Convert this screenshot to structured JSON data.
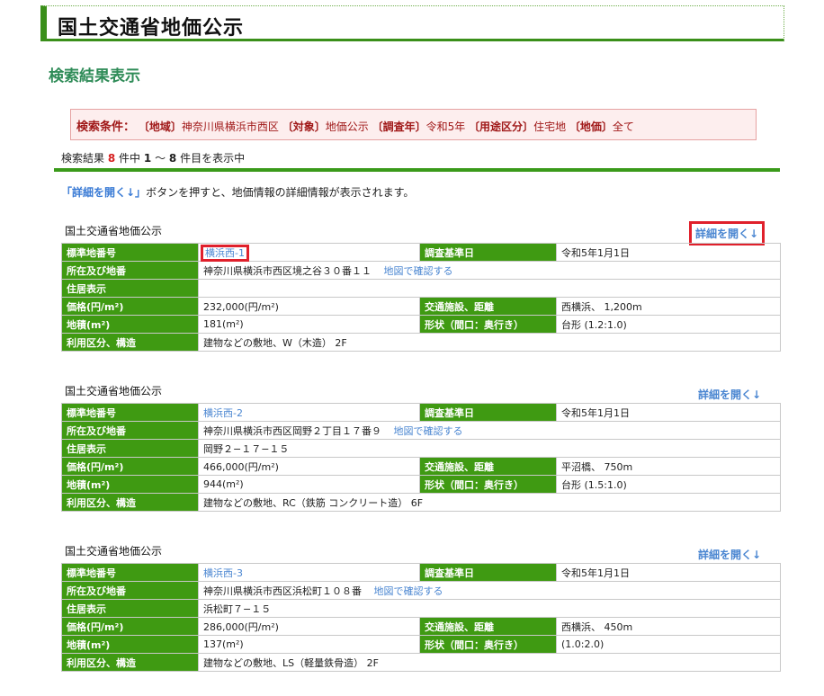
{
  "header": {
    "title": "国土交通省地価公示"
  },
  "section_title": "検索結果表示",
  "conditions": {
    "lead": "検索条件：",
    "region_label": "〔地域〕",
    "region_value": "神奈川県横浜市西区",
    "target_label": "〔対象〕",
    "target_value": "地価公示",
    "year_label": "〔調査年〕",
    "year_value": "令和5年",
    "use_label": "〔用途区分〕",
    "use_value": "住宅地",
    "price_label": "〔地価〕",
    "price_value": "全て"
  },
  "result_count": {
    "prefix": "検索結果",
    "total": "8",
    "mid": "件中",
    "from": "1",
    "tilde": "～",
    "to": "8",
    "suffix": "件目を表示中"
  },
  "instruction": {
    "link_text": "「詳細を開く↓」",
    "rest": "ボタンを押すと、地価情報の詳細情報が表示されます。"
  },
  "labels": {
    "std_no": "標準地番号",
    "survey_date": "調査基準日",
    "location": "所在及び地番",
    "residence": "住居表示",
    "price": "価格(円/m²)",
    "transport": "交通施設、距離",
    "area": "地積(m²)",
    "shape": "形状（間口：奥行き）",
    "usage": "利用区分、構造",
    "map_link": "地図で確認する"
  },
  "records": [
    {
      "block_title": "国土交通省地価公示",
      "detail_link": "詳細を開く↓",
      "std_no": "横浜西-1",
      "survey_date": "令和5年1月1日",
      "location": "神奈川県横浜市西区境之谷３０番１１",
      "residence": "",
      "price": "232,000(円/m²)",
      "transport": "西横浜、 1,200m",
      "area": "181(m²)",
      "shape": "台形 (1.2:1.0)",
      "usage": "建物などの敷地、W（木造） 2F"
    },
    {
      "block_title": "国土交通省地価公示",
      "detail_link": "詳細を開く↓",
      "std_no": "横浜西-2",
      "survey_date": "令和5年1月1日",
      "location": "神奈川県横浜市西区岡野２丁目１７番９",
      "residence": "岡野２−１７−１５",
      "price": "466,000(円/m²)",
      "transport": "平沼橋、 750m",
      "area": "944(m²)",
      "shape": "台形 (1.5:1.0)",
      "usage": "建物などの敷地、RC（鉄筋 コンクリート造） 6F"
    },
    {
      "block_title": "国土交通省地価公示",
      "detail_link": "詳細を開く↓",
      "std_no": "横浜西-3",
      "survey_date": "令和5年1月1日",
      "location": "神奈川県横浜市西区浜松町１０８番",
      "residence": "浜松町７−１５",
      "price": "286,000(円/m²)",
      "transport": "西横浜、 450m",
      "area": "137(m²)",
      "shape": "(1.0:2.0)",
      "usage": "建物などの敷地、LS（軽量鉄骨造） 2F"
    }
  ]
}
